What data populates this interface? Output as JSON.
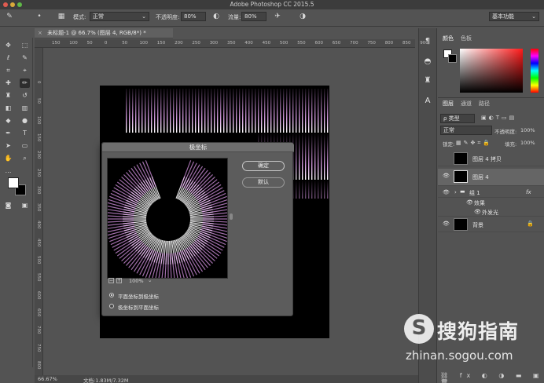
{
  "window": {
    "title": "Adobe Photoshop CC 2015.5"
  },
  "options_bar": {
    "mode_label": "模式:",
    "mode_value": "正常",
    "opacity_label": "不透明度:",
    "opacity_value": "80%",
    "flow_label": "流量:",
    "flow_value": "80%",
    "workspace": "基本功能"
  },
  "document": {
    "tab_title": "未标题-1 @ 66.7% (图层 4, RGB/8*) *",
    "close_glyph": "×"
  },
  "ruler": {
    "h_ticks": [
      "150",
      "100",
      "50",
      "0",
      "50",
      "100",
      "150",
      "200",
      "250",
      "300",
      "350",
      "400",
      "450",
      "500",
      "550",
      "600",
      "650",
      "700",
      "750",
      "800",
      "850",
      "900"
    ],
    "v_ticks": [
      "0",
      "50",
      "100",
      "150",
      "200",
      "250",
      "300",
      "350",
      "400",
      "450",
      "500",
      "550",
      "600",
      "650",
      "700",
      "750",
      "800"
    ]
  },
  "status": {
    "zoom": "66.67%",
    "doc_size": "文档:1.83M/7.32M"
  },
  "dialog": {
    "title": "极坐标",
    "ok": "确定",
    "default": "默认",
    "zoom": "100%",
    "option_rect_to_polar": "平面坐标到极坐标",
    "option_polar_to_rect": "极坐标到平面坐标",
    "selected_option": "平面坐标到极坐标"
  },
  "right_panel": {
    "color_tabs": [
      "颜色",
      "色板"
    ],
    "layer_tabs": [
      "图层",
      "通道",
      "路径"
    ],
    "filter_label": "ρ 类型",
    "blend_mode": "正常",
    "opacity_label": "不透明度:",
    "opacity_value": "100%",
    "lock_label": "锁定:",
    "fill_label": "填充:",
    "fill_value": "100%",
    "layers": [
      {
        "name": "图层 4 拷贝",
        "selected": false,
        "visible": false
      },
      {
        "name": "图层 4",
        "selected": true,
        "visible": true
      },
      {
        "name": "组 1",
        "selected": false,
        "visible": true,
        "fx": "fx"
      },
      {
        "name": "效果",
        "selected": false,
        "visible": true
      },
      {
        "name": "外发光",
        "selected": false,
        "visible": true
      },
      {
        "name": "背景",
        "selected": false,
        "visible": true
      }
    ]
  },
  "watermark": {
    "logo": "S",
    "name": "搜狗指南",
    "url": "zhinan.sogou.com"
  },
  "colors": {
    "accent_purple": "#e39bf0",
    "canvas_bg": "#000000",
    "panel_bg": "#535353"
  }
}
